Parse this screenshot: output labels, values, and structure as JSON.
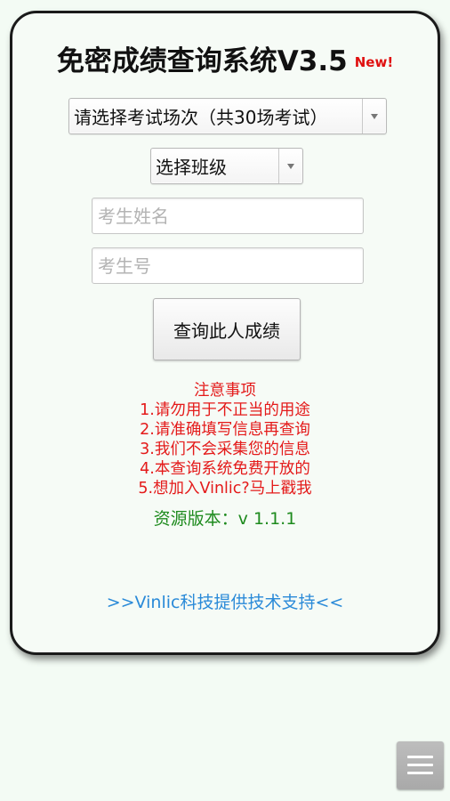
{
  "header": {
    "title": "免密成绩查询系统V3.5",
    "badge": "New!"
  },
  "form": {
    "exam_select": {
      "selected": "请选择考试场次（共30场考试）"
    },
    "class_select": {
      "selected": "选择班级"
    },
    "name_input": {
      "value": "",
      "placeholder": "考生姓名"
    },
    "id_input": {
      "value": "",
      "placeholder": "考生号"
    },
    "submit_label": "查询此人成绩"
  },
  "notice": {
    "heading": "注意事项",
    "items": [
      "1.请勿用于不正当的用途",
      "2.请准确填写信息再查询",
      "3.我们不会采集您的信息",
      "4.本查询系统免费开放的",
      "5.想加入Vinlic?马上戳我"
    ]
  },
  "version": "资源版本：v 1.1.1",
  "support_link": ">>Vinlic科技提供技术支持<<",
  "icons": {
    "dropdown": "chevron-down-icon",
    "menu": "menu-icon"
  },
  "colors": {
    "background": "#f3fbf4",
    "card_border": "#1a1a1a",
    "notice_text": "#e41a1a",
    "version_text": "#1d8a1d",
    "link_text": "#2a8ad8",
    "badge_text": "#e01010"
  }
}
